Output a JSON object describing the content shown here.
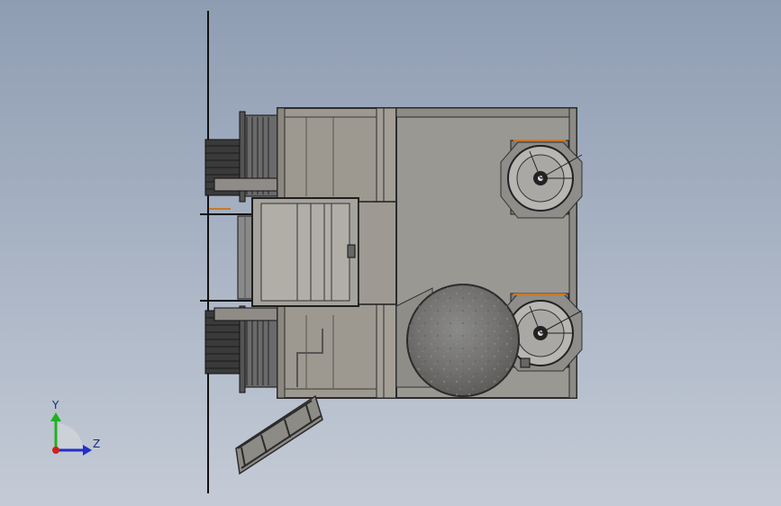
{
  "triad": {
    "y_label": "Y",
    "z_label": "Z",
    "colors": {
      "y": "#1fb21f",
      "z": "#2030c8",
      "origin": "#d02020"
    }
  },
  "palette": {
    "body_fill": "#9d9990",
    "deck_fill": "#9a9893",
    "outline": "#2b2b2b",
    "accent_orange": "#c87a2a"
  }
}
